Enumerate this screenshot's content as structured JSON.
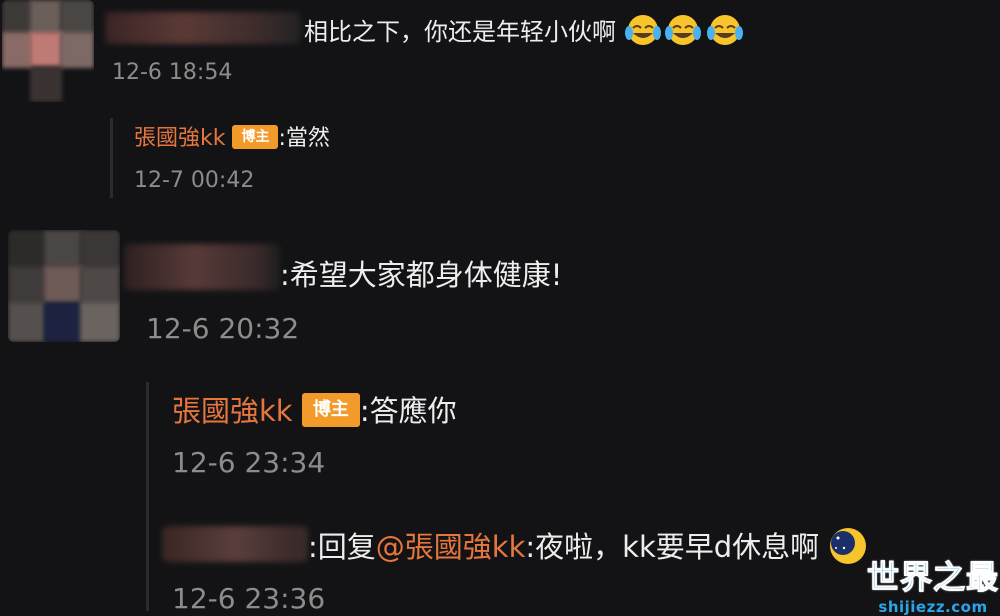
{
  "comments": [
    {
      "text": "相比之下，你还是年轻小伙啊",
      "time": "12-6 18:54",
      "emoji": [
        "laugh-cry-emoji",
        "laugh-cry-emoji",
        "laugh-cry-emoji"
      ],
      "reply": {
        "author": "張國強kk",
        "badge": "博主",
        "text": ":當然",
        "time": "12-7 00:42"
      }
    },
    {
      "text": ":希望大家都身体健康!",
      "time": "12-6 20:32",
      "reply": {
        "author": "張國強kk",
        "badge": "博主",
        "text": ":答應你",
        "time": "12-6 23:34"
      },
      "reply2": {
        "prefix": ":回复",
        "mention": "@張國強kk",
        "text": ":夜啦，kk要早d休息啊",
        "time": "12-6 23:36",
        "emoji": "moon-night-emoji"
      }
    }
  ],
  "watermark": {
    "main": "世界之最",
    "sub": "shijiezz.com"
  },
  "colors": {
    "background": "#131316",
    "author": "#e5763e",
    "badge": "#f29b2a",
    "meta": "#8c8c8c",
    "watermark": "#2aa6e8"
  }
}
